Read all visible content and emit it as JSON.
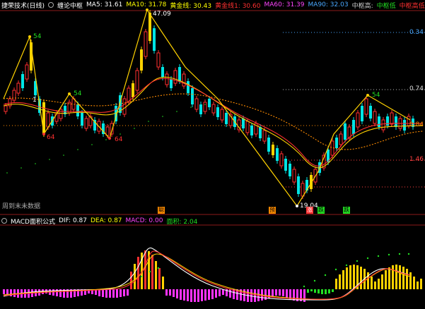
{
  "header": {
    "title": "捷荣技术(日线)",
    "indicator": "缠论中枢",
    "ma": [
      {
        "label": "MA5: 31.61",
        "color": "#ffffff"
      },
      {
        "label": "MA10: 31.78",
        "color": "#ffff00"
      },
      {
        "label": "黄金线: 30.43",
        "color": "#ffff00"
      },
      {
        "label": "黄金线1: 30.60",
        "color": "#ff3030"
      },
      {
        "label": "MA60: 31.39",
        "color": "#ff44ff"
      },
      {
        "label": "MA90: 32.03",
        "color": "#4aa8ff"
      },
      {
        "label": "中枢高:",
        "color": "#cccccc"
      },
      {
        "label": "中枢低",
        "color": "#22dd22"
      },
      {
        "label": "中枢高低",
        "color": "#ff3030"
      },
      {
        "label": "中枢",
        "color": "#22dd22"
      }
    ]
  },
  "price_labels": {
    "p47": "47.09",
    "p19": "19.04",
    "n54a": "54",
    "n54b": "54",
    "n54c": "54",
    "n64": "64",
    "n1": "1"
  },
  "right_labels": {
    "r1": "0.34",
    "r2": "0.74",
    "r3": "0.84",
    "r4": "1.46"
  },
  "note": "周到末未数据",
  "marks": {
    "m1": "聪",
    "m2": "预",
    "m3": "涨",
    "m4": "跌",
    "m5": "跌"
  },
  "macd": {
    "title": "MACD面积公式",
    "dif": "DIF: 0.87",
    "dea": "DEA: 0.87",
    "macd": "MACD: 0.00",
    "area": "面积: 2.04"
  },
  "colors": {
    "up": "#ff3030",
    "down": "#00ffff",
    "yellow": "#ffd200",
    "magenta": "#ff33ff",
    "green": "#22dd22"
  }
}
